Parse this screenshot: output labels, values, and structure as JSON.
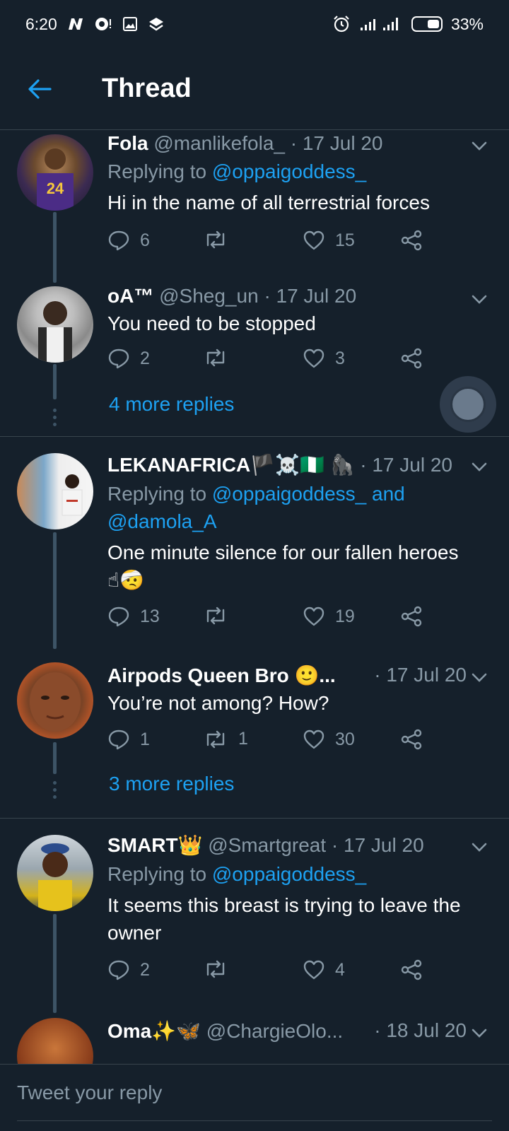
{
  "status_bar": {
    "time": "6:20",
    "battery": "33%",
    "icons": [
      "notification-n-icon",
      "chat-icon",
      "gallery-icon",
      "layers-icon",
      "alarm-icon",
      "signal-icon",
      "battery-icon"
    ]
  },
  "header": {
    "title": "Thread",
    "back_icon": "arrow-left-icon"
  },
  "accent_color": "#1da1f2",
  "tweets": [
    {
      "name": "Fola",
      "handle": "@manlikefola_",
      "date": "· 17 Jul 20",
      "replying_label": "Replying to",
      "replying_to": "@oppaigoddess_",
      "text": "Hi in the name of all terrestrial forces",
      "replies": "6",
      "retweets": "",
      "likes": "15"
    },
    {
      "name": "oA™",
      "handle": "@Sheg_un",
      "date": "· 17 Jul 20",
      "text": "You need to be stopped",
      "replies": "2",
      "retweets": "",
      "likes": "3",
      "more_replies": "4 more replies"
    },
    {
      "name": "LEKANAFRICA",
      "name_emoji": "🏴☠️🇳🇬 🦍",
      "handle": "",
      "date": "· 17 Jul 20",
      "replying_label": "Replying to",
      "replying_to": "@oppaigoddess_",
      "replying_and": "and",
      "replying_to_2": "@damola_A",
      "text": "One minute silence for our fallen heroes",
      "text_emoji": "☝🤕",
      "replies": "13",
      "retweets": "",
      "likes": "19"
    },
    {
      "name": "Airpods Queen Bro 🙂...",
      "handle": "",
      "date": "· 17 Jul 20",
      "text": "You’re not among? How?",
      "replies": "1",
      "retweets": "1",
      "likes": "30",
      "more_replies": "3 more replies"
    },
    {
      "name": "SMART",
      "name_emoji": "👑",
      "handle": "@Smartgreat",
      "date": "· 17 Jul 20",
      "replying_label": "Replying to",
      "replying_to": "@oppaigoddess_",
      "text": "It seems this breast is trying to leave the owner",
      "replies": "2",
      "retweets": "",
      "likes": "4"
    },
    {
      "name": "Oma",
      "name_emoji": "✨🦋",
      "handle": "@ChargieOlo...",
      "date": "· 18 Jul 20"
    }
  ],
  "reply_bar": {
    "placeholder": "Tweet your reply"
  }
}
